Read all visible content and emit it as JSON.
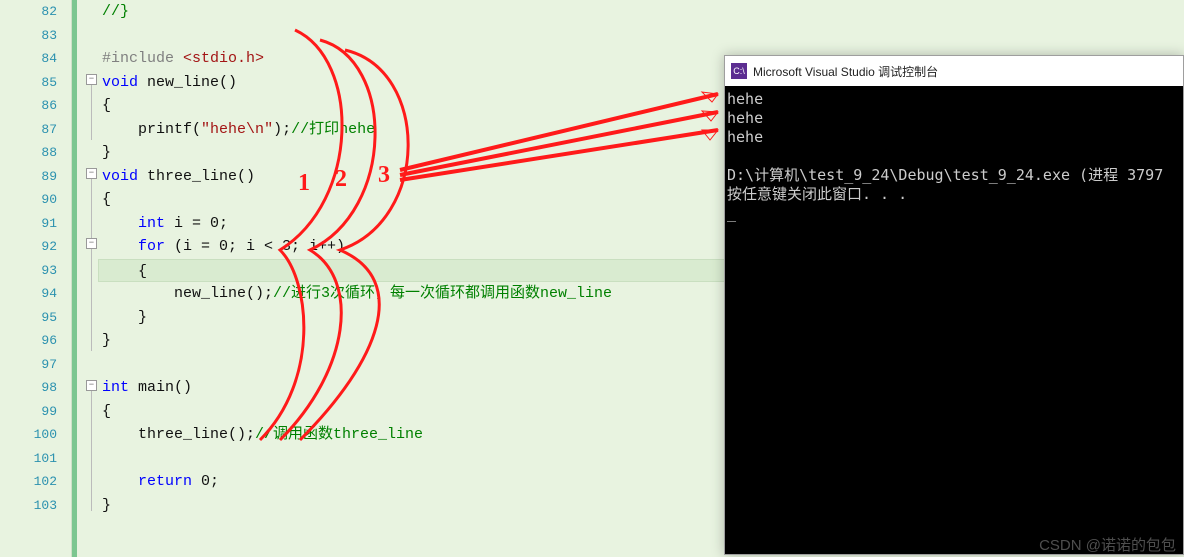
{
  "lineNumbers": [
    "82",
    "83",
    "84",
    "85",
    "86",
    "87",
    "88",
    "89",
    "90",
    "91",
    "92",
    "93",
    "94",
    "95",
    "96",
    "97",
    "98",
    "99",
    "100",
    "101",
    "102",
    "103"
  ],
  "code": {
    "l82": "//}",
    "l84_pref": "#include ",
    "l84_inc": "<stdio.h>",
    "l85_kw": "void",
    "l85_fn": " new_line()",
    "l86": "{",
    "l87_pre": "    printf(",
    "l87_str1": "\"hehe",
    "l87_esc": "\\n",
    "l87_str2": "\"",
    "l87_post": ");",
    "l87_cmt": "//打印hehe",
    "l88": "}",
    "l89_kw": "void",
    "l89_fn": " three_line()",
    "l90": "{",
    "l91_kw": "    int",
    "l91_rest": " i = 0;",
    "l92_kw": "    for",
    "l92_rest": " (i = 0; i < 3; i++)",
    "l93": "    {",
    "l94_call": "        new_line();",
    "l94_cmt": "//进行3次循环，每一次循环都调用函数new_line",
    "l95": "    }",
    "l96": "}",
    "l98_kw": "int",
    "l98_fn": " main()",
    "l99": "{",
    "l100_call": "    three_line();",
    "l100_cmt": "//调用函数three_line",
    "l102_kw": "    return",
    "l102_rest": " 0;",
    "l103": "}"
  },
  "console": {
    "title": "Microsoft Visual Studio 调试控制台",
    "icon_text": "C:\\",
    "out1": "hehe",
    "out2": "hehe",
    "out3": "hehe",
    "blank": "",
    "path": "D:\\计算机\\test_9_24\\Debug\\test_9_24.exe (进程 3797",
    "prompt": "按任意键关闭此窗口. . ."
  },
  "annotation": {
    "n1": "1",
    "n2": "2",
    "n3": "3"
  },
  "watermark": "CSDN @诺诺的包包"
}
